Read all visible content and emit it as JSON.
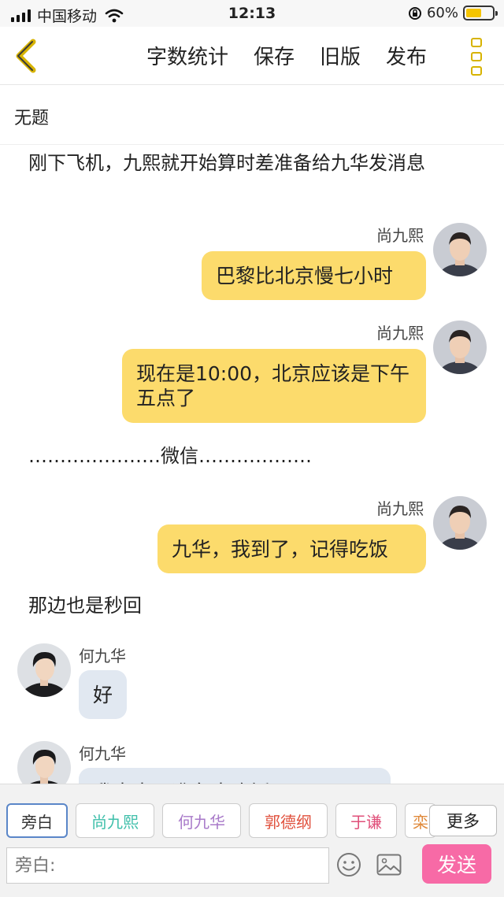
{
  "status_bar": {
    "carrier": "中国移动",
    "time": "12:13",
    "battery_percent": "60%",
    "battery_level": 0.6
  },
  "nav": {
    "back_icon": "chevron-left-icon",
    "actions": [
      "字数统计",
      "保存",
      "旧版",
      "发布"
    ],
    "more_icon": "vertical-dots-icon"
  },
  "title": "无题",
  "messages": [
    {
      "type": "narration",
      "text": "刚下飞机，九熙就开始算时差准备给九华发消息"
    },
    {
      "type": "right",
      "sender": "尚九熙",
      "text": "巴黎比北京慢七小时"
    },
    {
      "type": "right",
      "sender": "尚九熙",
      "text": "现在是10:00，北京应该是下午五点了"
    },
    {
      "type": "narration",
      "text": "…………………微信………………"
    },
    {
      "type": "right",
      "sender": "尚九熙",
      "text": "九华，我到了，记得吃饭"
    },
    {
      "type": "narration",
      "text": "那边也是秒回"
    },
    {
      "type": "left",
      "sender": "何九华",
      "text": "好"
    },
    {
      "type": "left",
      "sender": "何九华",
      "text": "我本来正准备去吃饭"
    }
  ],
  "characters": [
    {
      "name": "旁白",
      "color": "#333333",
      "selected": true
    },
    {
      "name": "尚九熙",
      "color": "#3fbfaa",
      "selected": false
    },
    {
      "name": "何九华",
      "color": "#a879c9",
      "selected": false
    },
    {
      "name": "郭德纲",
      "color": "#e0503c",
      "selected": false
    },
    {
      "name": "于谦",
      "color": "#e0507a",
      "selected": false
    },
    {
      "name": "栾",
      "color": "#e08a3c",
      "selected": false
    }
  ],
  "more_label": "更多",
  "input_placeholder": "旁白:",
  "send_label": "发送",
  "colors": {
    "accent_yellow": "#fcdb6c",
    "left_bubble": "#e1e8f1",
    "send_button": "#f76aa6"
  }
}
